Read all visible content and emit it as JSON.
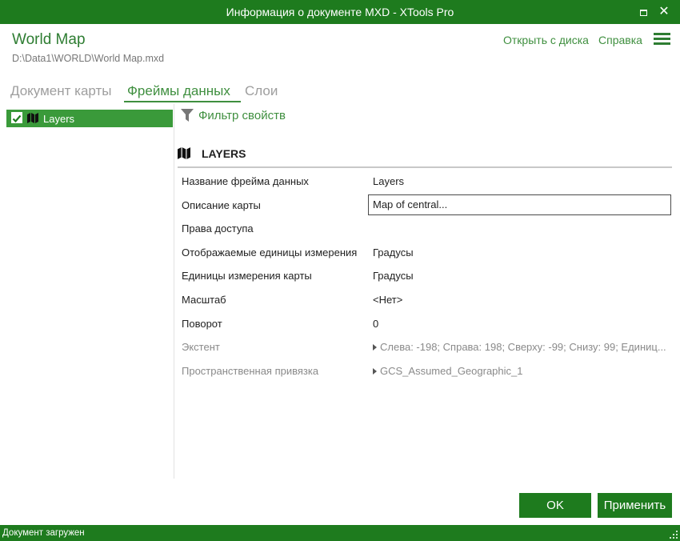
{
  "window": {
    "title": "Информация о документе MXD - XTools Pro"
  },
  "header": {
    "title": "World Map",
    "path": "D:\\Data1\\WORLD\\World Map.mxd",
    "open_link": "Открыть с диска",
    "help_link": "Справка"
  },
  "tabs": [
    {
      "label": "Документ карты",
      "active": false
    },
    {
      "label": "Фреймы данных",
      "active": true
    },
    {
      "label": "Слои",
      "active": false
    }
  ],
  "tree": {
    "items": [
      {
        "label": "Layers",
        "checked": true,
        "icon": "map-icon"
      }
    ]
  },
  "filter": {
    "label": "Фильтр свойств",
    "icon": "funnel-icon"
  },
  "section": {
    "title": "LAYERS",
    "icon": "map-icon"
  },
  "properties": [
    {
      "name": "Название фрейма данных",
      "value": "Layers",
      "editable": false,
      "disabled": false
    },
    {
      "name": "Описание карты",
      "value": "Map of central...",
      "editable": true,
      "disabled": false
    },
    {
      "name": "Права доступа",
      "value": "",
      "editable": false,
      "disabled": false
    },
    {
      "name": "Отображаемые единицы измерения",
      "value": "Градусы",
      "editable": false,
      "disabled": false
    },
    {
      "name": "Единицы измерения карты",
      "value": "Градусы",
      "editable": false,
      "disabled": false
    },
    {
      "name": "Масштаб",
      "value": "<Нет>",
      "editable": false,
      "disabled": false
    },
    {
      "name": "Поворот",
      "value": "0",
      "editable": false,
      "disabled": false
    },
    {
      "name": "Экстент",
      "value": "Слева: -198; Справа: 198; Сверху: -99; Снизу: 99; Единиц...",
      "editable": false,
      "disabled": true,
      "expandable": true
    },
    {
      "name": "Пространственная привязка",
      "value": "GCS_Assumed_Geographic_1",
      "editable": false,
      "disabled": true,
      "expandable": true
    }
  ],
  "buttons": {
    "ok": "OK",
    "apply": "Применить"
  },
  "status": {
    "text": "Документ загружен"
  },
  "colors": {
    "accent": "#1e7b1e",
    "link": "#3f8f3f",
    "selection": "#3a9a3a"
  }
}
